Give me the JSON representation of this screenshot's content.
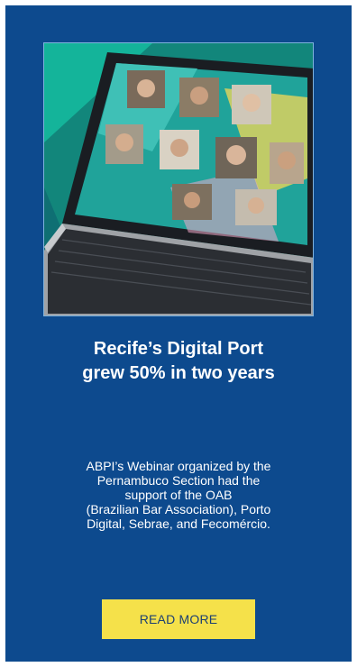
{
  "card": {
    "title_lines": [
      "Recife’s Digital Port",
      "grew 50% in two years"
    ],
    "description_lines": [
      "ABPI’s Webinar organized by the",
      "Pernambuco Section had the",
      "support of the OAB",
      "(Brazilian Bar Association), Porto",
      "Digital, Sebrae, and Fecomércio."
    ],
    "button_label": "READ MORE"
  },
  "colors": {
    "card_background": "#0d4a8e",
    "button_background": "#f5e14a",
    "button_text": "#1c3f73"
  }
}
